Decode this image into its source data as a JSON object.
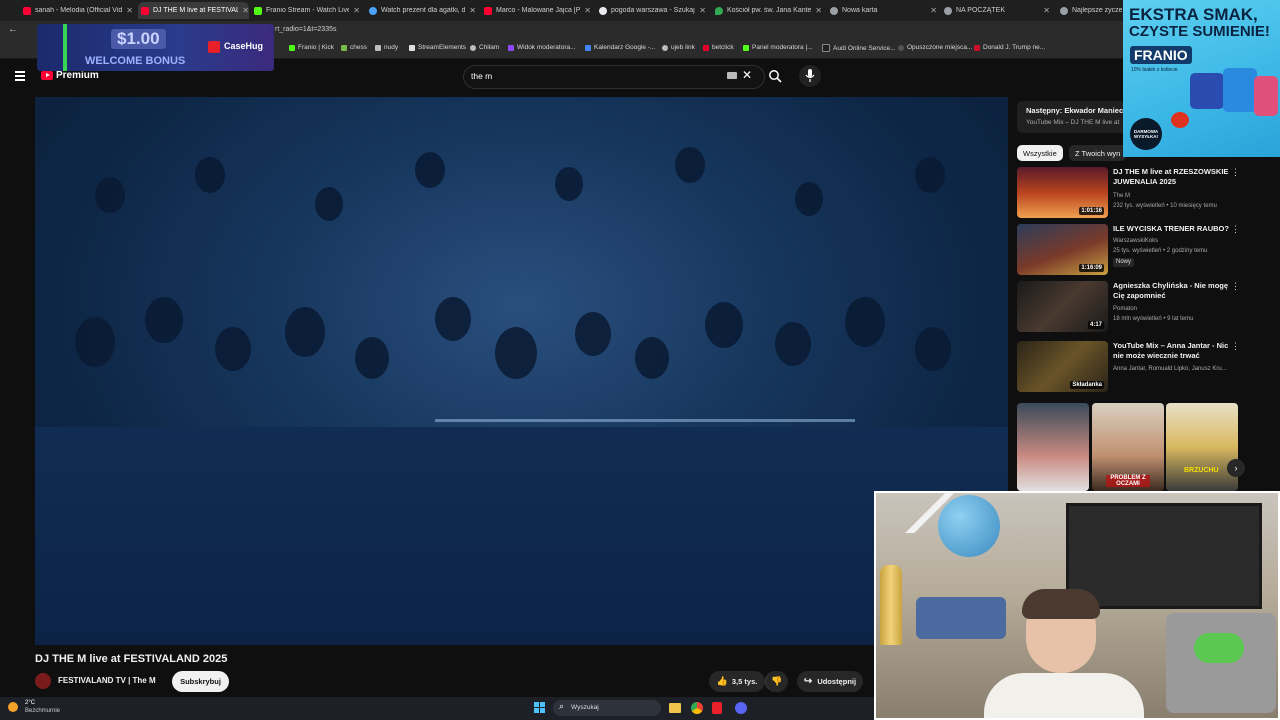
{
  "tabs": [
    {
      "label": "sanah - Melodia (Official Vide",
      "color": "#ff0033"
    },
    {
      "label": "DJ THE M live at FESTIVALAND",
      "color": "#ff0033"
    },
    {
      "label": "Franio Stream - Watch Live on",
      "color": "#53fc18"
    },
    {
      "label": "Watch prezent dla agatki, darm",
      "color": "#4aa3ff"
    },
    {
      "label": "Marco - Malowane Jajca [Pari",
      "color": "#ff0033"
    },
    {
      "label": "pogoda warszawa - Szukaj w",
      "color": "#e8eaed"
    },
    {
      "label": "Kościół pw. św. Jana Kantego",
      "color": "#34a853"
    },
    {
      "label": "Nowa karta",
      "color": "#9aa0a6"
    },
    {
      "label": "NA POCZĄTEK",
      "color": "#9aa0a6"
    },
    {
      "label": "Najlepsze życzenia",
      "color": "#9aa0a6"
    }
  ],
  "address": {
    "text": "rt_radio=1&t=2335s"
  },
  "bookmarks": [
    {
      "label": "Franio | Kick",
      "color": "#53fc18"
    },
    {
      "label": "chess",
      "color": "#81b64c"
    },
    {
      "label": "nudy",
      "color": "#bdbdbd"
    },
    {
      "label": "StreamElements",
      "color": "#e0e0e0"
    },
    {
      "label": "Chiłam",
      "color": "#bdbdbd"
    },
    {
      "label": "Widok moderatora...",
      "color": "#9146ff"
    },
    {
      "label": "Kalendarz Google -...",
      "color": "#4285f4"
    },
    {
      "label": "ujeb link",
      "color": "#bdbdbd"
    },
    {
      "label": "betclick",
      "color": "#e4002b"
    },
    {
      "label": "Panel moderatora |...",
      "color": "#53fc18"
    },
    {
      "label": "Audi Online Service...",
      "color": "#222222"
    },
    {
      "label": "Opuszczone miejsca...",
      "color": "#555555"
    },
    {
      "label": "Donald J. Trump ne...",
      "color": "#c8102e"
    }
  ],
  "youtube": {
    "logo_label": "Premium",
    "search_value": "the m"
  },
  "video": {
    "title": "DJ THE M live at FESTIVALAND 2025",
    "channel": "FESTIVALAND TV | The M",
    "subscribe_label": "Subskrybuj",
    "likes": "3,5 tys.",
    "share_label": "Udostępnij"
  },
  "sidebar": {
    "up_next": "Następny: Ekwador Maniecz",
    "up_next_sub": "YouTube Mix – DJ THE M live at",
    "chips": [
      "Wszystkie",
      "Z Twoich wyn"
    ],
    "recommendations": [
      {
        "title": "DJ THE M live at RZESZOWSKIE JUWENALIA 2025",
        "channel": "The M",
        "stats": "232 tys. wyświetleń • 10 miesięcy temu",
        "badge": "",
        "duration": "1:01:16"
      },
      {
        "title": "ILE WYCISKA TRENER RAUBO?",
        "channel": "WarszawskiKoks",
        "stats": "25 tys. wyświetleń • 2 godziny temu",
        "badge": "Nowy",
        "duration": "1:16:09"
      },
      {
        "title": "Agnieszka Chylińska - Nie mogę Cię zapomnieć",
        "channel": "Pomaton",
        "stats": "18 mln wyświetleń • 9 lat temu",
        "badge": "",
        "duration": "4:17"
      },
      {
        "title": "YouTube Mix – Anna Jantar - Nic nie może wiecznie trwać",
        "channel": "Anna Jantar, Romuald Lipko, Janusz Kru...",
        "stats": "",
        "badge": "",
        "duration": "Składanka"
      }
    ],
    "shorts": [
      {
        "caption": ""
      },
      {
        "caption": "PROBLEM Z OCZAMI"
      },
      {
        "caption": "BRZUCHU"
      }
    ]
  },
  "ad": {
    "headline_1": "EKSTRA SMAK,",
    "headline_2": "CZYSTE SUMIENIE!",
    "brand": "FRANIO",
    "sub": "10% białek z kotlecie",
    "badge": "DARMOWA WYSYŁKA!"
  },
  "casino": {
    "amount": "$1.00",
    "line": "WELCOME BONUS",
    "brand": "CaseHug"
  },
  "taskbar": {
    "weather_temp": "2°C",
    "weather_desc": "Bezchmurnie",
    "search_placeholder": "Wyszukaj"
  }
}
